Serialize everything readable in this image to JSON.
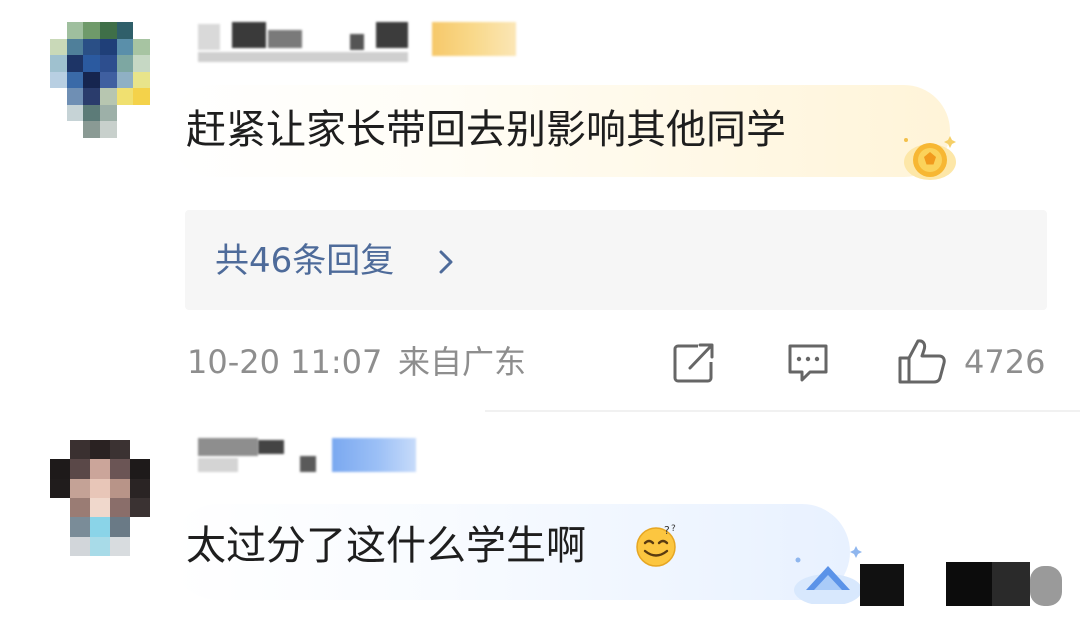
{
  "comments": [
    {
      "username": "",
      "text": "赶紧让家长带回去别影响其他同学",
      "replies_link": "共46条回复",
      "time": "10-20 11:07",
      "location": "来自广东",
      "like_count": "4726"
    },
    {
      "username": "",
      "text": "太过分了这什么学生啊"
    }
  ],
  "icons": {
    "badge_1": "gold-vip-badge-icon",
    "chevron": "chevron-right-icon",
    "share": "share-icon",
    "comment": "comment-icon",
    "like": "thumbs-up-icon",
    "emoji": "sweat-smile-emoji-icon",
    "badge_2": "blue-vip-badge-icon"
  },
  "colors": {
    "link": "#4e6b9a",
    "meta_text": "#8e8e8e",
    "reply_box_bg": "#f6f6f6",
    "gold_bubble": "#fff4d8",
    "blue_bubble": "#e8f1ff"
  }
}
